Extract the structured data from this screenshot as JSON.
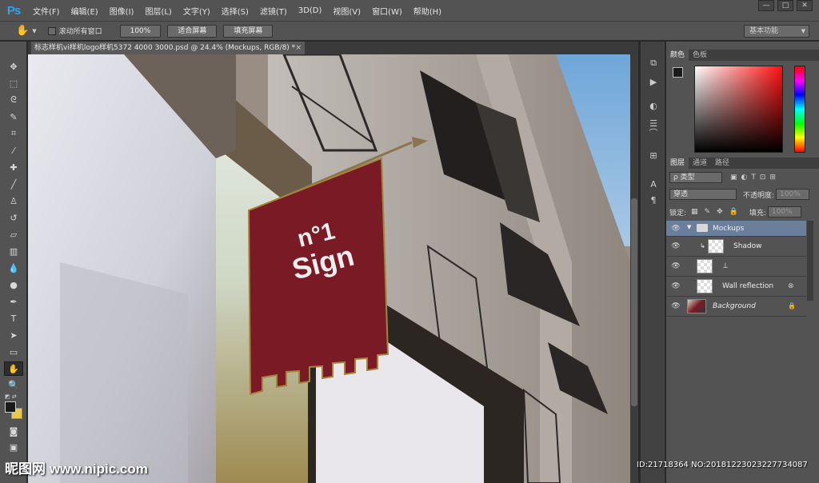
{
  "app": {
    "logo": "Ps"
  },
  "menu": [
    "文件(F)",
    "编辑(E)",
    "图像(I)",
    "图层(L)",
    "文字(Y)",
    "选择(S)",
    "滤镜(T)",
    "3D(D)",
    "视图(V)",
    "窗口(W)",
    "帮助(H)"
  ],
  "window_controls": {
    "minimize": "—",
    "restore": "□",
    "close": "✕"
  },
  "options": {
    "scroll_all_windows": "滚动所有窗口",
    "zoom_100": "100%",
    "fit_screen": "适合屏幕",
    "fill_screen": "填充屏幕",
    "workspace": "基本功能"
  },
  "document": {
    "tab_title": "标志样机vi样机logo样机5372 4000 3000.psd @ 24.4% (Mockups, RGB/8) *",
    "close": "×"
  },
  "sign": {
    "line1": "n°1",
    "line2": "Sign"
  },
  "color_panel": {
    "tabs": [
      "颜色",
      "色板"
    ],
    "fg_color": "#1a1a1a",
    "bg_color": "#e9c84b"
  },
  "layers_panel": {
    "tabs": [
      "图层",
      "通道",
      "路径"
    ],
    "filter_kind": "ρ 类型",
    "blend_mode": "穿透",
    "opacity_label": "不透明度:",
    "opacity_value": "100%",
    "lock_label": "锁定:",
    "fill_label": "填充:",
    "fill_value": "100%",
    "layers": [
      {
        "name": "Mockups",
        "type": "group"
      },
      {
        "name": "Shadow",
        "type": "layer"
      },
      {
        "name": "⊥",
        "type": "smart"
      },
      {
        "name": "Wall reflection",
        "type": "smart"
      },
      {
        "name": "Background",
        "type": "background"
      }
    ]
  },
  "watermark": {
    "left": "昵图网 www.nipic.com",
    "right": "ID:21718364 NO:20181223023227734087"
  }
}
